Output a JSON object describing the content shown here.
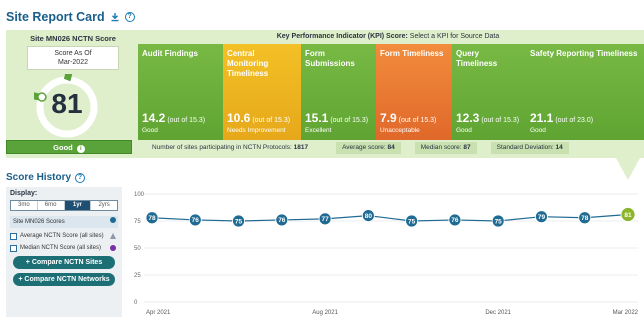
{
  "header": {
    "title": "Site Report Card"
  },
  "site_score": {
    "title": "Site MN026 NCTN Score",
    "as_of_label": "Score As Of",
    "as_of_date": "Mar-2022",
    "value": "81",
    "fraction": 0.81,
    "rating_label": "Good",
    "colors": {
      "ring": "#5aa23a",
      "ring_track": "#ffffff"
    }
  },
  "kpi": {
    "title_bold": "Key Performance Indicator (KPI) Score:",
    "title_rest": " Select a KPI for Source Data",
    "items": [
      {
        "name": "Audit Findings",
        "score": "14.2",
        "out_of": "(out of 15.3)",
        "rating": "Good",
        "color": "green"
      },
      {
        "name": "Central Monitoring Timeliness",
        "score": "10.6",
        "out_of": "(out of 15.3)",
        "rating": "Needs Improvement",
        "color": "yellow"
      },
      {
        "name": "Form Submissions",
        "score": "15.1",
        "out_of": "(out of 15.3)",
        "rating": "Excellent",
        "color": "green"
      },
      {
        "name": "Form Timeliness",
        "score": "7.9",
        "out_of": "(out of 15.3)",
        "rating": "Unacceptable",
        "color": "orange"
      },
      {
        "name": "Query Timeliness",
        "score": "12.3",
        "out_of": "(out of 15.3)",
        "rating": "Good",
        "color": "green"
      },
      {
        "name": "Safety Reporting Timeliness",
        "score": "21.1",
        "out_of": "(out of 23.0)",
        "rating": "Good",
        "color": "green"
      }
    ]
  },
  "stats": {
    "sites_label": "Number of sites participating in NCTN Protocols:",
    "sites_value": "1817",
    "average_label": "Average score:",
    "average_value": "84",
    "median_label": "Median score:",
    "median_value": "87",
    "stddev_label": "Standard Deviation:",
    "stddev_value": "14"
  },
  "history": {
    "title": "Score History",
    "display_label": "Display:",
    "ranges": [
      "3mo",
      "6mo",
      "1yr",
      "2yrs"
    ],
    "active_range": "1yr",
    "site_scores_label": "Site MN026 Scores",
    "average_label": "Average NCTN Score (all sites)",
    "median_label": "Median NCTN Score (all sites)",
    "compare_sites_label": "+ Compare NCTN Sites",
    "compare_networks_label": "+ Compare NCTN Networks"
  },
  "chart_data": {
    "type": "line",
    "x": [
      "Apr 2021",
      "May 2021",
      "Jun 2021",
      "Jul 2021",
      "Aug 2021",
      "Sep 2021",
      "Oct 2021",
      "Nov 2021",
      "Dec 2021",
      "Jan 2022",
      "Feb 2022",
      "Mar 2022"
    ],
    "series": [
      {
        "name": "Site MN026 Scores",
        "values": [
          78,
          76,
          75,
          76,
          77,
          80,
          75,
          76,
          75,
          79,
          78,
          81
        ]
      }
    ],
    "x_tick_labels": [
      "Apr 2021",
      "Aug 2021",
      "Dec 2021",
      "Mar 2022"
    ],
    "y_ticks": [
      0,
      25,
      50,
      75,
      100
    ],
    "ylim": [
      0,
      100
    ],
    "grid": true,
    "colors": {
      "line": "#1f6b93",
      "point": "#1f6b93",
      "last_point": "#8cb52b",
      "grid": "#e3e7eb"
    }
  }
}
